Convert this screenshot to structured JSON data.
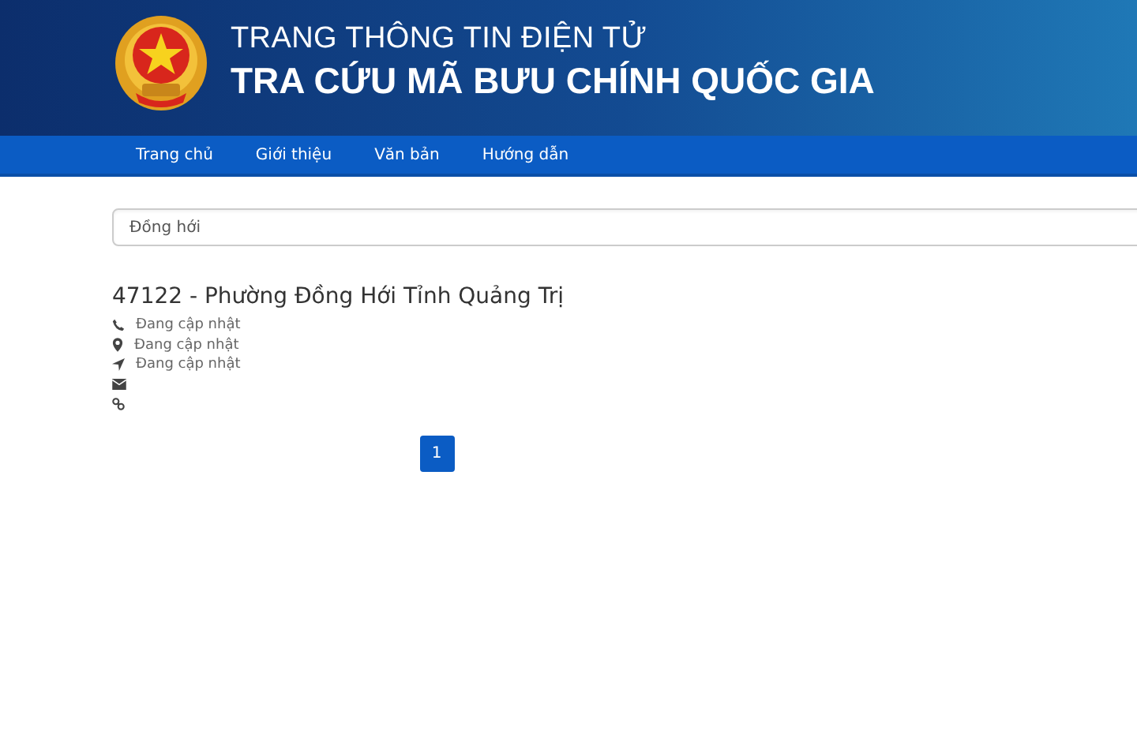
{
  "header": {
    "subtitle": "TRANG THÔNG TIN ĐIỆN TỬ",
    "title": "TRA CỨU MÃ BƯU CHÍNH QUỐC GIA"
  },
  "nav": {
    "items": [
      {
        "label": "Trang chủ"
      },
      {
        "label": "Giới thiệu"
      },
      {
        "label": "Văn bản"
      },
      {
        "label": "Hướng dẫn"
      }
    ]
  },
  "search": {
    "value": "Đồng hới"
  },
  "result": {
    "title": "47122 - Phường Đồng Hới Tỉnh Quảng Trị",
    "details": [
      {
        "kind": "phone",
        "text": "Đang cập nhật"
      },
      {
        "kind": "location",
        "text": "Đang cập nhật"
      },
      {
        "kind": "direction",
        "text": "Đang cập nhật"
      },
      {
        "kind": "email"
      },
      {
        "kind": "link"
      }
    ]
  },
  "pagination": [
    {
      "label": "1",
      "selected": true
    }
  ]
}
